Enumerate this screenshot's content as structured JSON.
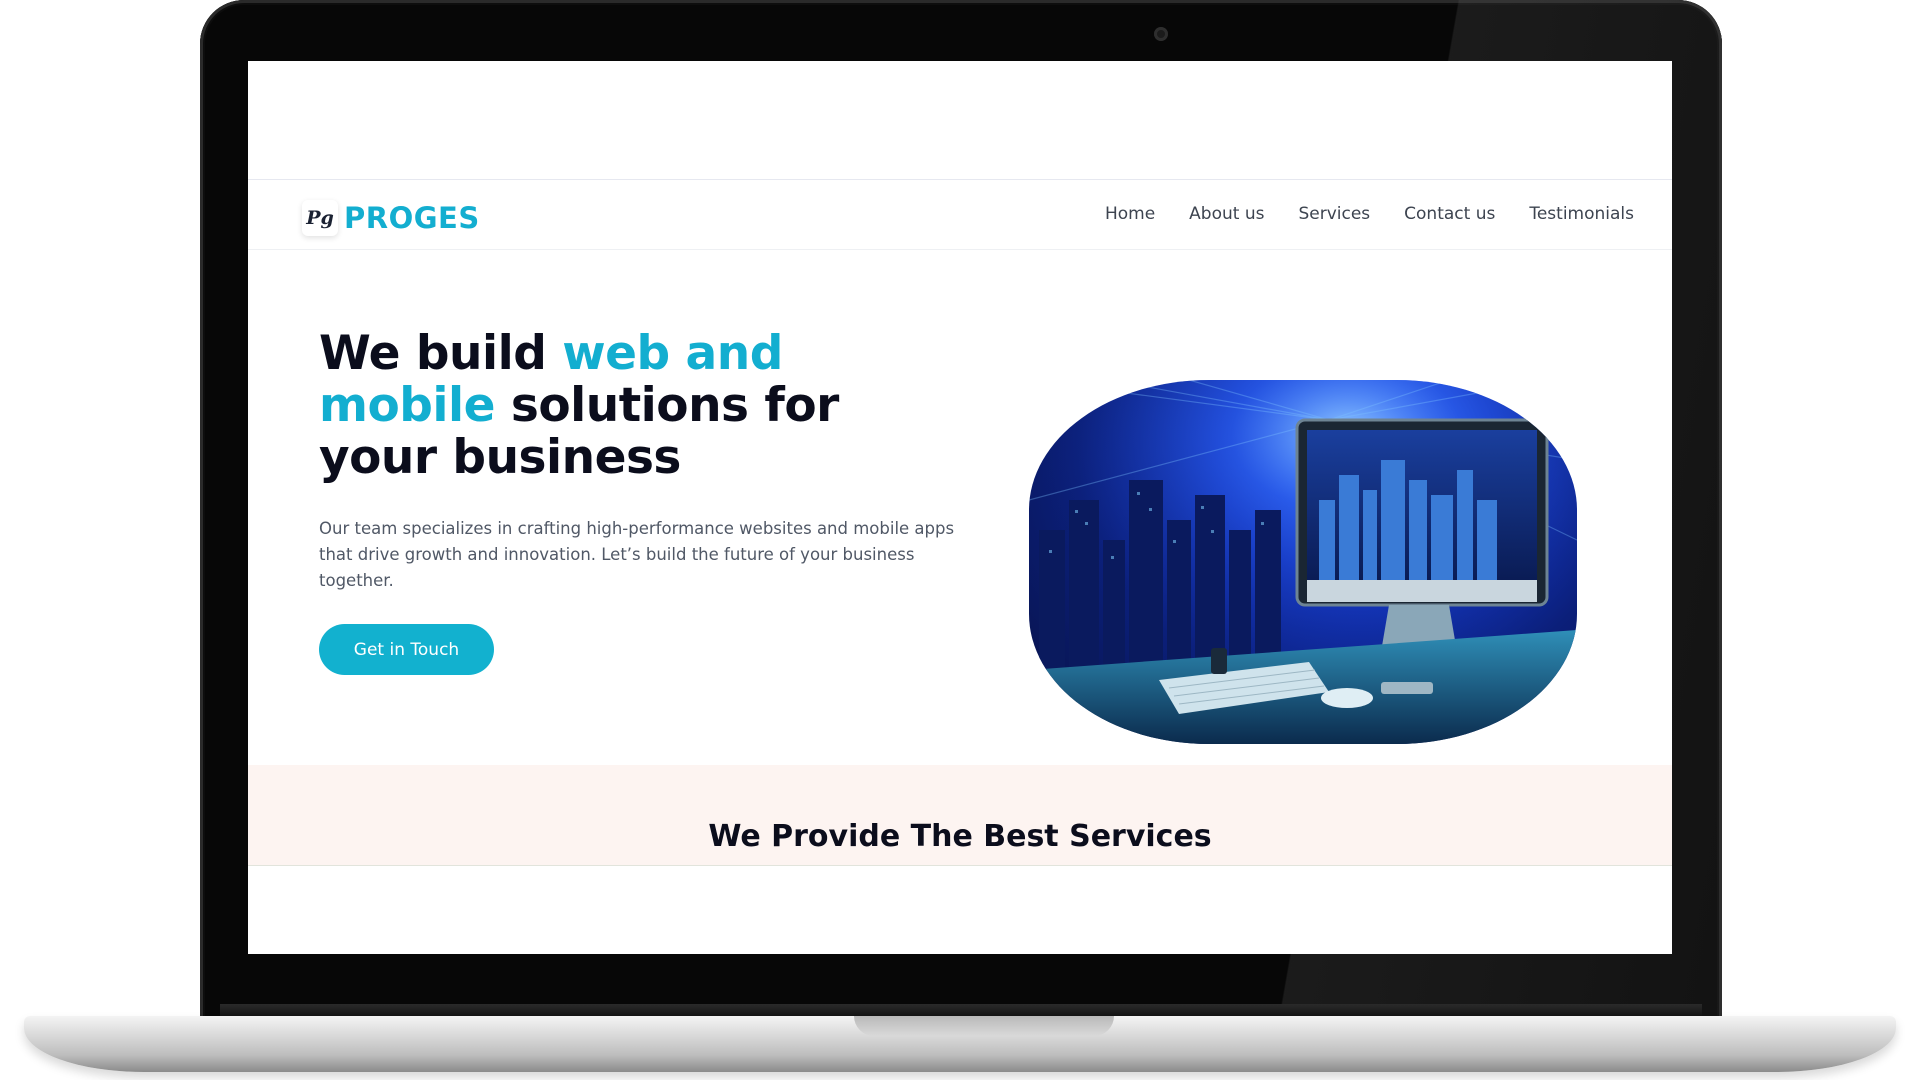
{
  "brand": {
    "name": "PROGES",
    "logo_mark": "Pg",
    "accent_color": "#13aed0"
  },
  "nav": {
    "links": [
      {
        "label": "Home"
      },
      {
        "label": "About us"
      },
      {
        "label": "Services"
      },
      {
        "label": "Contact us"
      },
      {
        "label": "Testimonials"
      }
    ]
  },
  "hero": {
    "title_part1": "We build ",
    "title_accent": "web and mobile",
    "title_part2": " solutions for your business",
    "description": "Our team specializes in crafting high-performance websites and mobile apps that drive growth and innovation. Let’s build the future of your business together.",
    "cta_label": "Get in Touch",
    "cta_color": "#12b1cf",
    "image_icon": "computer-city-illustration"
  },
  "services": {
    "title": "We Provide The Best Services",
    "background": "#fdf4f1"
  }
}
